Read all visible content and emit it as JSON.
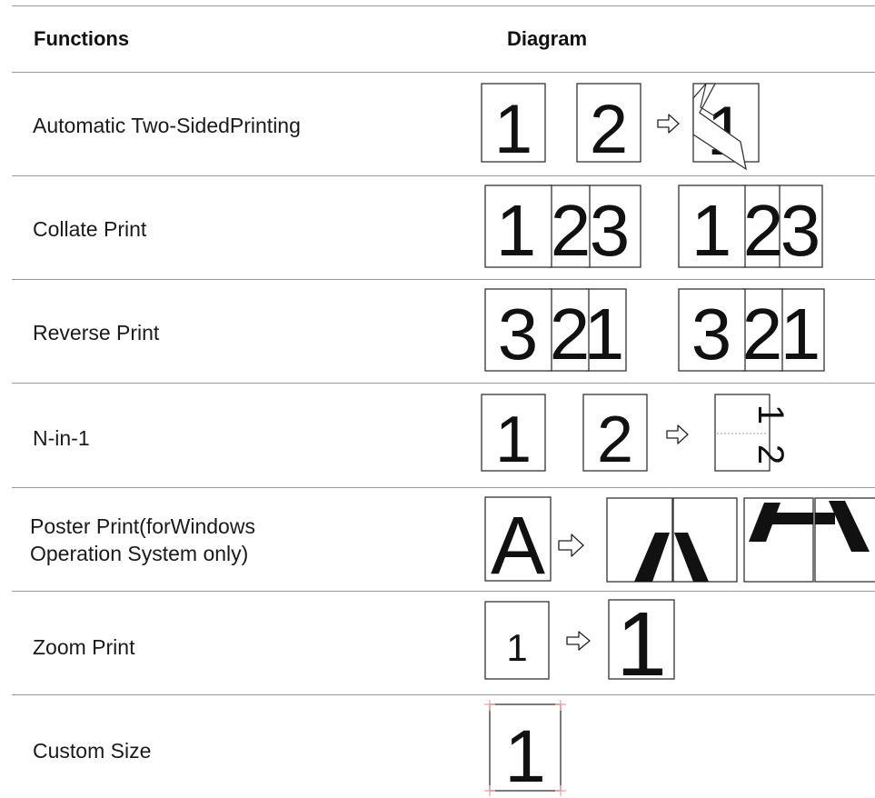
{
  "header": {
    "functions": "Functions",
    "diagram": "Diagram"
  },
  "rows": [
    {
      "label": "Automatic Two-SidedPrinting",
      "diagram": {
        "left": [
          "1",
          "2"
        ],
        "result": "1"
      }
    },
    {
      "label": "Collate Print",
      "diagram": {
        "set1": [
          "1",
          "2",
          "3"
        ],
        "set2": [
          "1",
          "2",
          "3"
        ]
      }
    },
    {
      "label": "Reverse Print",
      "diagram": {
        "set1": [
          "3",
          "2",
          "1"
        ],
        "set2": [
          "3",
          "2",
          "1"
        ]
      }
    },
    {
      "label": "N-in-1",
      "diagram": {
        "left": [
          "1",
          "2"
        ],
        "result_top": "1",
        "result_bottom": "2"
      }
    },
    {
      "label_line1": "Poster Print(forWindows",
      "label_line2": "Operation System only)",
      "diagram": {
        "source": "A"
      }
    },
    {
      "label": "Zoom Print",
      "diagram": {
        "small": "1",
        "large": "1"
      }
    },
    {
      "label": "Custom Size",
      "diagram": {
        "page": "1"
      }
    }
  ],
  "colors": {
    "rule": "#9a9a9a",
    "page_border": "#333333",
    "crop_marks": "#e8a0a0"
  }
}
